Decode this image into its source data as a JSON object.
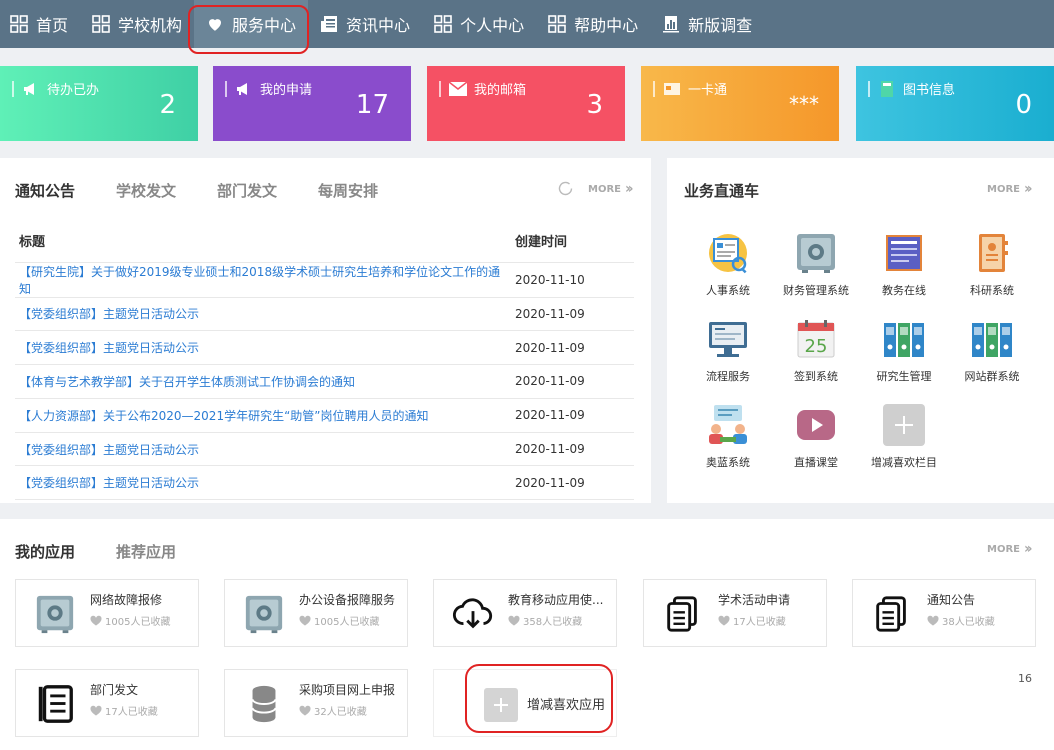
{
  "nav": {
    "items": [
      {
        "label": "首页",
        "icon": "grid-icon"
      },
      {
        "label": "学校机构",
        "icon": "grid-icon"
      },
      {
        "label": "服务中心",
        "icon": "heart-icon"
      },
      {
        "label": "资讯中心",
        "icon": "newspaper-icon"
      },
      {
        "label": "个人中心",
        "icon": "grid-icon"
      },
      {
        "label": "帮助中心",
        "icon": "grid-icon"
      },
      {
        "label": "新版调查",
        "icon": "survey-icon"
      }
    ]
  },
  "stats": [
    {
      "label": "待办已办",
      "value": "2",
      "icon": "megaphone-icon",
      "color": "#52e0ad"
    },
    {
      "label": "我的申请",
      "value": "17",
      "icon": "megaphone-icon",
      "color": "#8a4ccc"
    },
    {
      "label": "我的邮箱",
      "value": "3",
      "icon": "mail-icon",
      "color": "#f55164"
    },
    {
      "label": "一卡通",
      "value": "***",
      "icon": "card-icon",
      "color": "#f7a33a"
    },
    {
      "label": "图书信息",
      "value": "0",
      "icon": "book-icon",
      "color": "#22b5d6"
    }
  ],
  "notices": {
    "tabs": [
      "通知公告",
      "学校发文",
      "部门发文",
      "每周安排"
    ],
    "more": "MORE",
    "columns": [
      "标题",
      "创建时间"
    ],
    "rows": [
      {
        "title": "【研究生院】关于做好2019级专业硕士和2018级学术硕士研究生培养和学位论文工作的通知",
        "date": "2020-11-10"
      },
      {
        "title": "【党委组织部】主题党日活动公示",
        "date": "2020-11-09"
      },
      {
        "title": "【党委组织部】主题党日活动公示",
        "date": "2020-11-09"
      },
      {
        "title": "【体育与艺术教学部】关于召开学生体质测试工作协调会的通知",
        "date": "2020-11-09"
      },
      {
        "title": "【人力资源部】关于公布2020—2021学年研究生“助管”岗位聘用人员的通知",
        "date": "2020-11-09"
      },
      {
        "title": "【党委组织部】主题党日活动公示",
        "date": "2020-11-09"
      },
      {
        "title": "【党委组织部】主题党日活动公示",
        "date": "2020-11-09"
      }
    ]
  },
  "quick": {
    "title": "业务直通车",
    "more": "MORE",
    "items": [
      {
        "label": "人事系统",
        "icon": "hr-icon"
      },
      {
        "label": "财务管理系统",
        "icon": "safe-icon"
      },
      {
        "label": "教务在线",
        "icon": "document-icon"
      },
      {
        "label": "科研系统",
        "icon": "notebook-icon"
      },
      {
        "label": "流程服务",
        "icon": "monitor-icon"
      },
      {
        "label": "签到系统",
        "icon": "calendar-icon"
      },
      {
        "label": "研究生管理",
        "icon": "binders-icon"
      },
      {
        "label": "网站群系统",
        "icon": "binders-icon"
      },
      {
        "label": "奥蓝系统",
        "icon": "meeting-icon"
      },
      {
        "label": "直播课堂",
        "icon": "play-icon"
      },
      {
        "label": "增减喜欢栏目",
        "icon": "plus-icon"
      }
    ],
    "calendar_day": "25"
  },
  "apps": {
    "tabs": [
      "我的应用",
      "推荐应用"
    ],
    "more": "MORE",
    "items": [
      {
        "name": "网络故障报修",
        "fav": "1005人已收藏",
        "icon": "safe-icon"
      },
      {
        "name": "办公设备报障服务",
        "fav": "1005人已收藏",
        "icon": "safe-icon"
      },
      {
        "name": "教育移动应用使...",
        "fav": "358人已收藏",
        "icon": "cloud-download-icon"
      },
      {
        "name": "学术活动申请",
        "fav": "17人已收藏",
        "icon": "copy-icon"
      },
      {
        "name": "通知公告",
        "fav": "38人已收藏",
        "icon": "copy-icon"
      },
      {
        "name": "部门发文",
        "fav": "17人已收藏",
        "icon": "list-book-icon"
      },
      {
        "name": "采购项目网上申报",
        "fav": "32人已收藏",
        "icon": "database-icon"
      }
    ],
    "add_label": "增减喜欢应用"
  },
  "page_number": "16",
  "colors": {
    "nav_bg": "#5a7387",
    "link": "#2b7cd3",
    "highlight": "#e02323"
  }
}
